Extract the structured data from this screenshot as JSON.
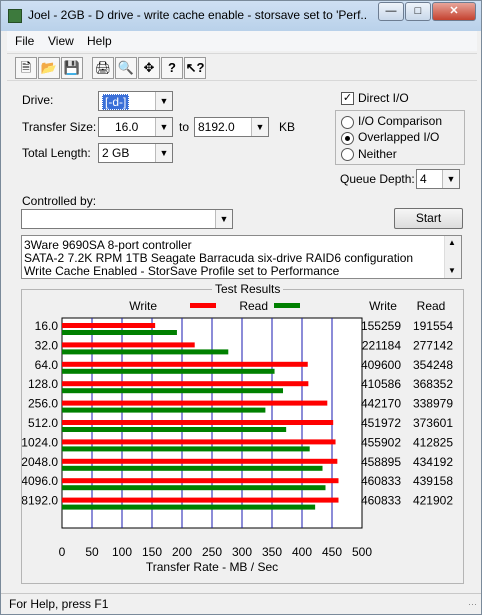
{
  "window": {
    "title": "Joel - 2GB - D drive - write cache enable - storsave set to 'Perf..."
  },
  "menu": {
    "file": "File",
    "view": "View",
    "help": "Help"
  },
  "toolbar": {
    "icons": [
      "new-icon",
      "open-icon",
      "save-icon",
      "print-icon",
      "print-preview-icon",
      "move-icon",
      "help-icon",
      "context-help-icon"
    ]
  },
  "drive": {
    "label": "Drive:",
    "value": "[-d-]"
  },
  "transfer": {
    "label": "Transfer Size:",
    "from": "16.0",
    "to_label": "to",
    "to": "8192.0",
    "unit": "KB"
  },
  "length": {
    "label": "Total Length:",
    "value": "2 GB"
  },
  "io": {
    "direct_label": "Direct I/O",
    "direct_checked": true,
    "opt_comparison": "I/O Comparison",
    "opt_overlapped": "Overlapped I/O",
    "opt_neither": "Neither",
    "selected": "Overlapped I/O",
    "queue_label": "Queue Depth:",
    "queue_value": "4"
  },
  "controlled": {
    "label": "Controlled by:",
    "value": ""
  },
  "start_label": "Start",
  "notes": [
    "3Ware 9690SA 8-port controller",
    "SATA-2 7.2K RPM 1TB Seagate Barracuda six-drive RAID6 configuration",
    "Write Cache Enabled - StorSave Profile set to Performance"
  ],
  "results": {
    "title": "Test Results",
    "legend_write": "Write",
    "legend_read": "Read",
    "col_write": "Write",
    "col_read": "Read"
  },
  "chart_data": {
    "type": "bar",
    "orientation": "horizontal",
    "categories": [
      "16.0",
      "32.0",
      "64.0",
      "128.0",
      "256.0",
      "512.0",
      "1024.0",
      "2048.0",
      "4096.0",
      "8192.0"
    ],
    "series": [
      {
        "name": "Write",
        "color": "#ff0000",
        "values": [
          155259,
          221184,
          409600,
          410586,
          442170,
          451972,
          455902,
          458895,
          460833,
          460833
        ]
      },
      {
        "name": "Read",
        "color": "#008000",
        "values": [
          191554,
          277142,
          354248,
          368352,
          338979,
          373601,
          412825,
          434192,
          439158,
          421902
        ]
      }
    ],
    "xlabel": "Transfer Rate - MB / Sec",
    "xticks": [
      0,
      50,
      100,
      150,
      200,
      250,
      300,
      350,
      400,
      450,
      500
    ],
    "xlim": [
      0,
      500
    ],
    "grid": true
  },
  "status": {
    "text": "For Help, press F1"
  }
}
